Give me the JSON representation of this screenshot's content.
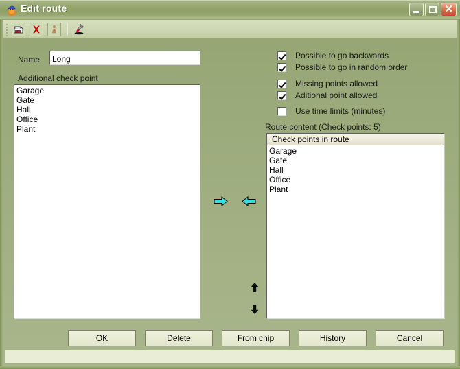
{
  "window": {
    "title": "Edit route",
    "app_icon": "person-hat-icon",
    "controls": {
      "minimize": "minimize-icon",
      "maximize": "maximize-icon",
      "close": "close-icon"
    }
  },
  "toolbar": {
    "items": [
      {
        "name": "save-icon",
        "tooltip": "Save"
      },
      {
        "name": "delete-icon",
        "tooltip": "Delete"
      },
      {
        "name": "user-info-icon",
        "tooltip": "Info"
      },
      {
        "name": "hammer-icon",
        "tooltip": "Tools"
      }
    ]
  },
  "form": {
    "name_label": "Name",
    "name_value": "Long",
    "name_placeholder": ""
  },
  "additional": {
    "label": "Additional check point",
    "items": [
      "Garage",
      "Gate",
      "Hall",
      "Office",
      "Plant"
    ]
  },
  "options": {
    "checkboxes": [
      {
        "label": "Possible to go backwards",
        "checked": true
      },
      {
        "label": "Possible to go in random order",
        "checked": true
      },
      {
        "label": "Missing points allowed",
        "checked": true
      },
      {
        "label": "Aditional point allowed",
        "checked": true
      },
      {
        "label": "Use time limits (minutes)",
        "checked": false
      }
    ]
  },
  "route_content": {
    "label": "Route content (Check points: 5)",
    "column_header": "Check points in route",
    "items": [
      "Garage",
      "Gate",
      "Hall",
      "Office",
      "Plant"
    ]
  },
  "transfer": {
    "add_icon": "arrow-right-icon",
    "remove_icon": "arrow-left-icon",
    "move_up_icon": "arrow-up-icon",
    "move_down_icon": "arrow-down-icon",
    "arrow_color": "#33dede"
  },
  "buttons": {
    "ok": "OK",
    "delete": "Delete",
    "from_chip": "From chip",
    "history": "History",
    "cancel": "Cancel"
  },
  "statusbar": {
    "text": ""
  },
  "colors": {
    "title_bar": "#93a46c",
    "body_top": "#93a472",
    "body_bottom": "#a9b68c",
    "toolbar": "#cdd7b2",
    "close_button": "#c8472a",
    "accent_arrow": "#33dede"
  }
}
